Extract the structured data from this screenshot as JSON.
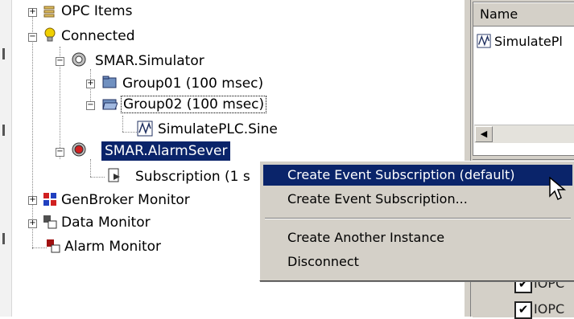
{
  "tree": {
    "opc_items": "OPC Items",
    "connected": "Connected",
    "simulator": "SMAR.Simulator",
    "group01": "Group01 (100 msec)",
    "group02": "Group02 (100 msec)",
    "sine": "SimulatePLC.Sine",
    "alarm_server": "SMAR.AlarmSever",
    "subscription": "Subscription (1 s",
    "genbroker": "GenBroker Monitor",
    "data_monitor": "Data Monitor",
    "alarm_monitor": "Alarm Monitor"
  },
  "right_panel": {
    "column_header": "Name",
    "list_item": "SimulatePl",
    "check1_label": "IOPC",
    "check2_label": "IOPC"
  },
  "context_menu": {
    "items": [
      "Create Event Subscription (default)",
      "Create Event Subscription...",
      "Create Another Instance",
      "Disconnect"
    ]
  },
  "colors": {
    "selection": "#0a246a",
    "menu_bg": "#d4d0c8"
  }
}
